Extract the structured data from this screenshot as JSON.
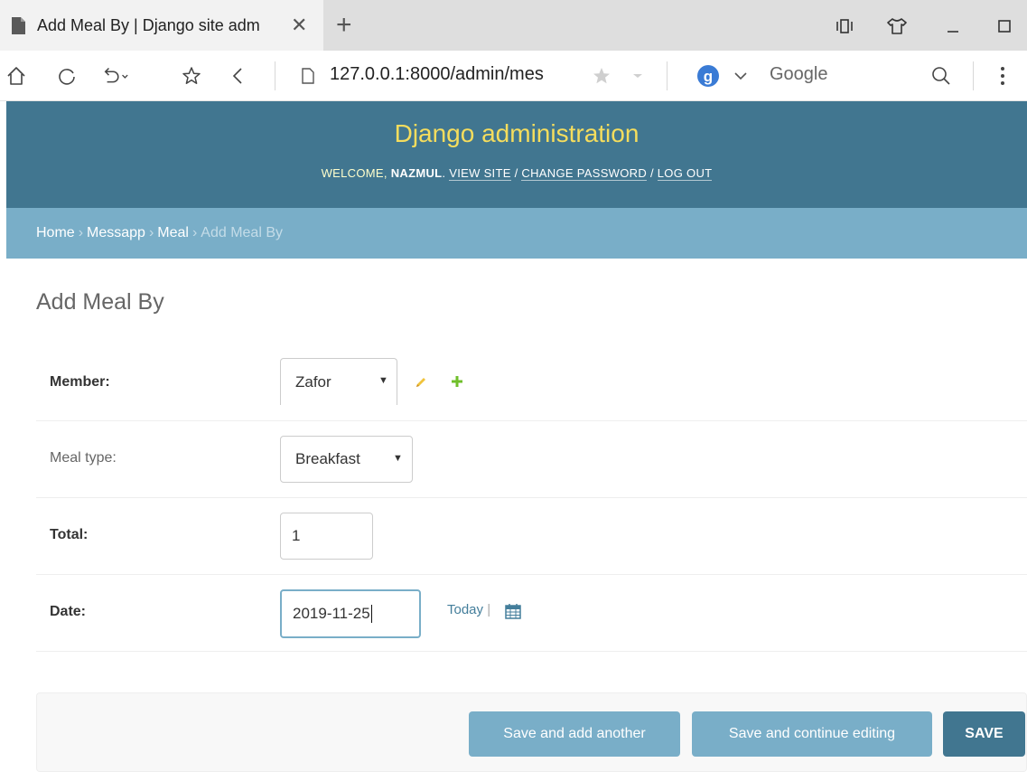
{
  "browser": {
    "tab_title": "Add Meal By | Django site adm",
    "url": "127.0.0.1:8000/admin/mes",
    "search_engine": "Google",
    "search_engine_icon_letter": "g"
  },
  "site": {
    "brand": "Django administration",
    "welcome": "Welcome,",
    "username": "nazmul",
    "view_site": "View site",
    "change_password": "Change password",
    "log_out": "Log out"
  },
  "breadcrumbs": {
    "home": "Home",
    "app": "Messapp",
    "model": "Meal",
    "current": "Add Meal By"
  },
  "page": {
    "title": "Add Meal By"
  },
  "form": {
    "member_label": "Member:",
    "member_value": "Zafor",
    "meal_type_label": "Meal type:",
    "meal_type_value": "Breakfast",
    "total_label": "Total:",
    "total_value": "1",
    "date_label": "Date:",
    "date_value": "2019-11-25",
    "today_label": "Today",
    "date_separator": "|"
  },
  "buttons": {
    "save_add_another": "Save and add another",
    "save_continue": "Save and continue editing",
    "save": "SAVE"
  },
  "colors": {
    "header_bg": "#417690",
    "breadcrumb_bg": "#79aec8",
    "brand_text": "#f5dd5d",
    "edit_icon": "#f0c33c",
    "add_icon": "#70bf2b"
  }
}
